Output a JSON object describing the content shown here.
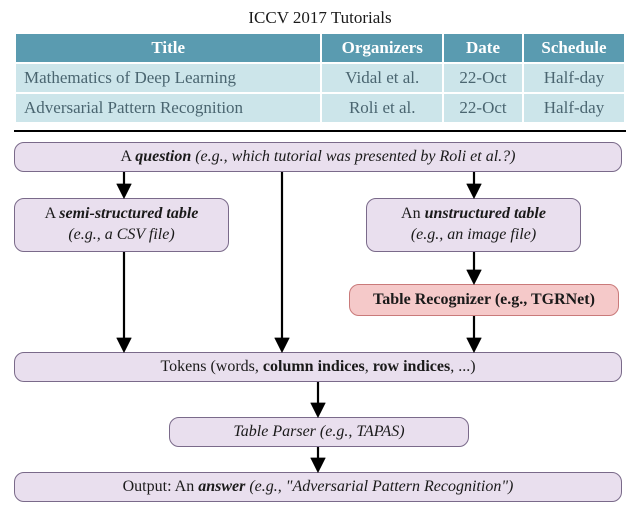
{
  "caption": "ICCV 2017 Tutorials",
  "table": {
    "headers": [
      "Title",
      "Organizers",
      "Date",
      "Schedule"
    ],
    "rows": [
      {
        "title": "Mathematics of Deep Learning",
        "organizers": "Vidal et al.",
        "date": "22-Oct",
        "schedule": "Half-day"
      },
      {
        "title": "Adversarial Pattern Recognition",
        "organizers": "Roli et al.",
        "date": "22-Oct",
        "schedule": "Half-day"
      }
    ]
  },
  "boxes": {
    "question": {
      "prefix": "A ",
      "keyword": "question",
      "example": " (e.g., which tutorial was presented by Roli et al.?)"
    },
    "semi": {
      "line1_prefix": "A ",
      "line1_keyword": "semi-structured table",
      "line2": "(e.g., a CSV file)"
    },
    "unstruct": {
      "line1_prefix": "An ",
      "line1_keyword": "unstructured table",
      "line2": "(e.g., an image file)"
    },
    "recognizer": {
      "label": "Table Recognizer (e.g., TGRNet)"
    },
    "tokens": {
      "p1": "Tokens (words, ",
      "p2": "column indices",
      "p3": ", ",
      "p4": "row indices",
      "p5": ", ...)"
    },
    "parser": {
      "label": "Table Parser (e.g., TAPAS)"
    },
    "output": {
      "p1": "Output: An ",
      "keyword": "answer",
      "p2": " (e.g., \"Adversarial Pattern Recognition\")"
    }
  }
}
